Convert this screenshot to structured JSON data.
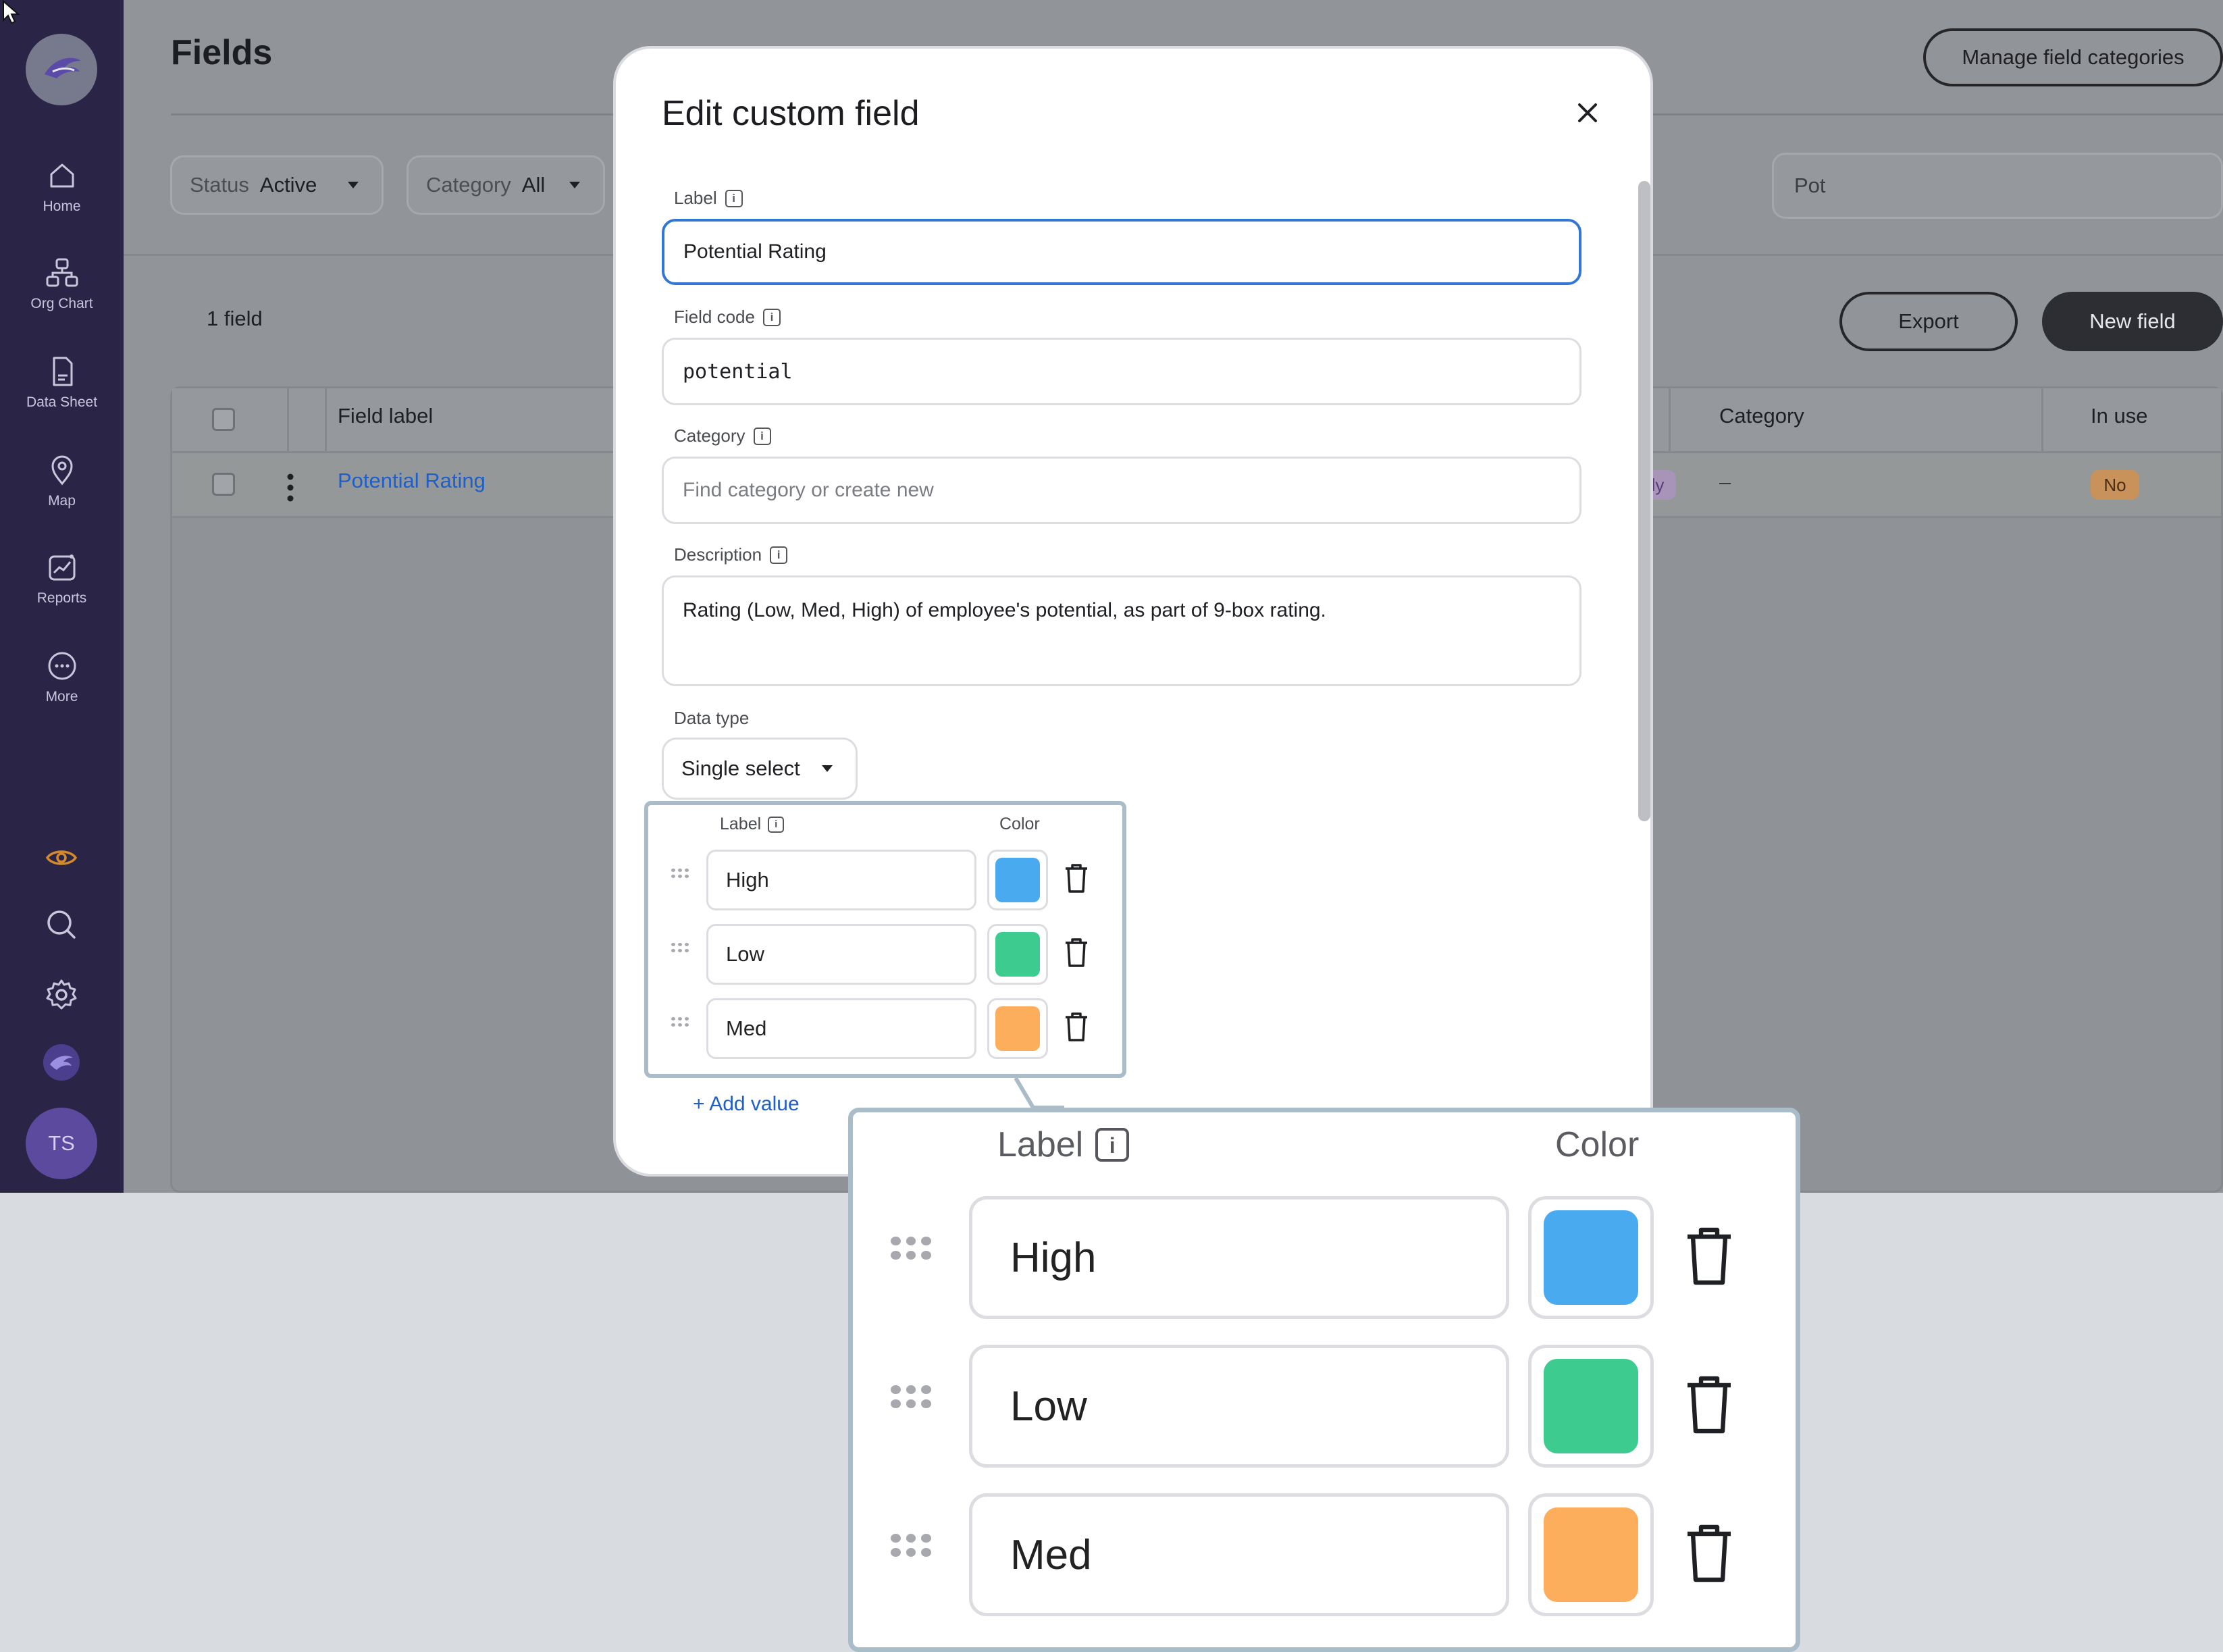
{
  "page": {
    "title": "Fields",
    "manage_btn": "Manage field categories",
    "filters": {
      "status_label": "Status",
      "status_value": "Active",
      "category_label": "Category",
      "category_value": "All"
    },
    "search_value": "Pot",
    "count": "1 field",
    "export_btn": "Export",
    "new_btn": "New field",
    "table": {
      "headers": [
        "Field label",
        "Category",
        "In use"
      ],
      "rows": [
        {
          "label": "Potential Rating",
          "status_tail": "ly",
          "category": "–",
          "in_use": "No"
        }
      ]
    }
  },
  "sidebar": {
    "items": [
      {
        "label": "Home",
        "icon": "home-icon"
      },
      {
        "label": "Org Chart",
        "icon": "org-chart-icon"
      },
      {
        "label": "Data Sheet",
        "icon": "data-sheet-icon"
      },
      {
        "label": "Map",
        "icon": "map-pin-icon"
      },
      {
        "label": "Reports",
        "icon": "reports-icon"
      },
      {
        "label": "More",
        "icon": "more-icon"
      }
    ],
    "avatar": "TS"
  },
  "modal": {
    "title": "Edit custom field",
    "label_label": "Label",
    "label_value": "Potential Rating",
    "code_label": "Field code",
    "code_value": "potential",
    "category_label": "Category",
    "category_placeholder": "Find category or create new",
    "desc_label": "Description",
    "desc_value": "Rating (Low, Med, High) of employee's potential, as part of 9-box rating.",
    "datatype_label": "Data type",
    "datatype_value": "Single select",
    "values_label_header": "Label",
    "values_color_header": "Color",
    "values": [
      {
        "label": "High",
        "color": "#4aaaf0"
      },
      {
        "label": "Low",
        "color": "#3ecb8f"
      },
      {
        "label": "Med",
        "color": "#fdae5c"
      }
    ],
    "add_value": "+ Add value"
  },
  "colors": {
    "sidebar_bg": "#2a2547",
    "accent_link": "#1f5fc9",
    "primary_btn": "#2c2e33",
    "in_use_badge": "#c8925a"
  }
}
